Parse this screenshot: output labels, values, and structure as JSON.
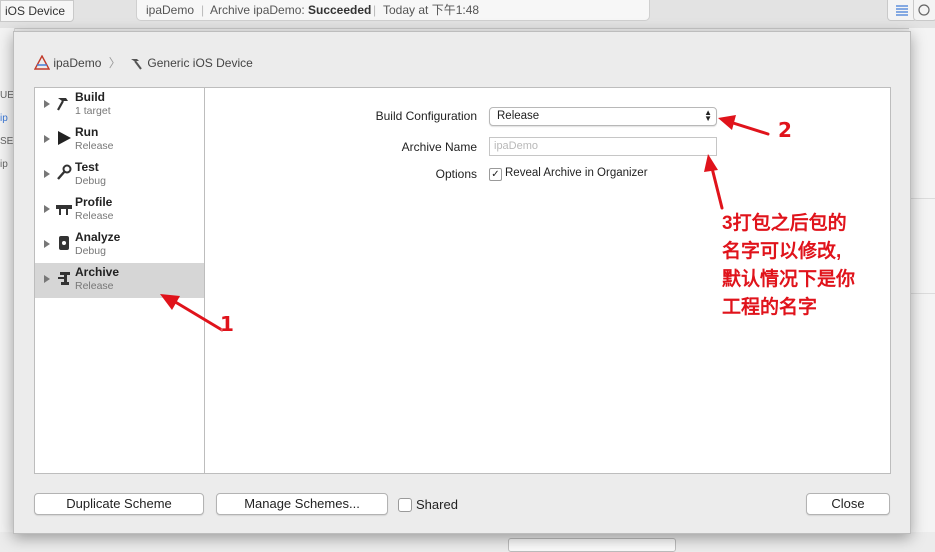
{
  "toolbar": {
    "device": "iOS Device",
    "activity": {
      "project": "ipaDemo",
      "status_prefix": "Archive ipaDemo:",
      "status_value": "Succeeded",
      "time": "Today at 下午1:48"
    }
  },
  "sidebar_fragments": [
    "UEC",
    "ip",
    "SET",
    "ip"
  ],
  "breadcrumb": {
    "project": "ipaDemo",
    "destination": "Generic iOS Device"
  },
  "actions": [
    {
      "title": "Build",
      "subtitle": "1 target",
      "icon": "hammer-icon"
    },
    {
      "title": "Run",
      "subtitle": "Release",
      "icon": "play-icon"
    },
    {
      "title": "Test",
      "subtitle": "Debug",
      "icon": "wrench-icon"
    },
    {
      "title": "Profile",
      "subtitle": "Release",
      "icon": "profile-icon"
    },
    {
      "title": "Analyze",
      "subtitle": "Debug",
      "icon": "analyze-icon"
    },
    {
      "title": "Archive",
      "subtitle": "Release",
      "icon": "archive-icon"
    }
  ],
  "selected_action": "Archive",
  "form": {
    "build_configuration_label": "Build Configuration",
    "build_configuration_value": "Release",
    "archive_name_label": "Archive Name",
    "archive_name_placeholder": "ipaDemo",
    "options_label": "Options",
    "reveal_archive_label": "Reveal Archive in Organizer",
    "reveal_archive_checked": true
  },
  "footer": {
    "duplicate_label": "Duplicate Scheme",
    "manage_label": "Manage Schemes...",
    "shared_label": "Shared",
    "shared_checked": false,
    "close_label": "Close"
  },
  "annotations": {
    "num1": "1",
    "num2": "2",
    "note_lines": [
      "3打包之后包的",
      "名字可以修改,",
      "默认情况下是你",
      "工程的名字"
    ],
    "color": "#e0131b"
  }
}
